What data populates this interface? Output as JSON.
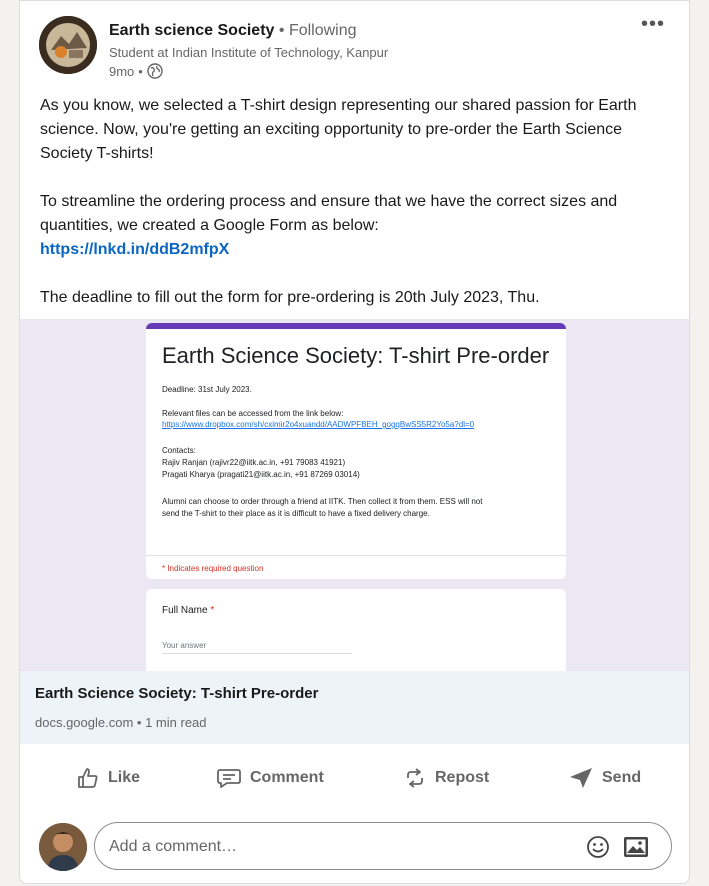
{
  "post": {
    "author": "Earth science Society",
    "separator": "•",
    "follow_status": "Following",
    "headline": "Student at Indian Institute of Technology, Kanpur",
    "time": "9mo",
    "meta_separator": "•",
    "visibility_icon": "globe-icon",
    "more_icon": "more-horizontal-icon",
    "more_label": "•••",
    "paragraph1": "As you know, we selected a T-shirt design representing our shared passion for Earth science. Now, you're getting an exciting opportunity to pre-order the Earth Science Society T-shirts!",
    "paragraph2": "To streamline the ordering process and ensure that we have the correct sizes and quantities, we created a Google Form as below:",
    "link": "https://lnkd.in/ddB2mfpX",
    "paragraph3": "The deadline to fill out the form for pre-ordering is 20th July 2023, Thu."
  },
  "preview": {
    "form_title": "Earth Science Society: T-shirt Pre-order",
    "deadline": "Deadline: 31st July 2023.",
    "files_note": "Relevant files can be accessed from the link below:",
    "files_url": "https://www.dropbox.com/sh/cximir2o4xuandd/AADWPFBEH_gogqBwSS5R2Yo5a?dl=0",
    "contacts_label": "Contacts:",
    "contact1": "Rajiv Ranjan (rajivr22@iitk.ac.in, +91 79083 41921)",
    "contact2": "Pragati Kharya (pragati21@iitk.ac.in, +91 87269 03014)",
    "alumni_line1": "Alumni can choose to order through a friend at IITK. Then collect it from them. ESS will not",
    "alumni_line2": "send the T-shirt to their place as it is difficult to have a fixed delivery charge.",
    "required_note": "* Indicates required question",
    "question_label": "Full Name",
    "question_star": "*",
    "answer_placeholder": "Your answer",
    "accent_color": "#673ab7"
  },
  "link_card": {
    "title": "Earth Science Society: T-shirt Pre-order",
    "source": "docs.google.com",
    "separator": "•",
    "read_time": "1 min read"
  },
  "actions": {
    "like": "Like",
    "comment": "Comment",
    "repost": "Repost",
    "send": "Send"
  },
  "comment": {
    "placeholder": "Add a comment…",
    "emoji_icon": "emoji-icon",
    "image_icon": "image-icon"
  },
  "colors": {
    "link": "#0a66c2",
    "muted": "#666666",
    "preview_bg": "#ebe8f4",
    "meta_bg": "#edf3f8"
  }
}
